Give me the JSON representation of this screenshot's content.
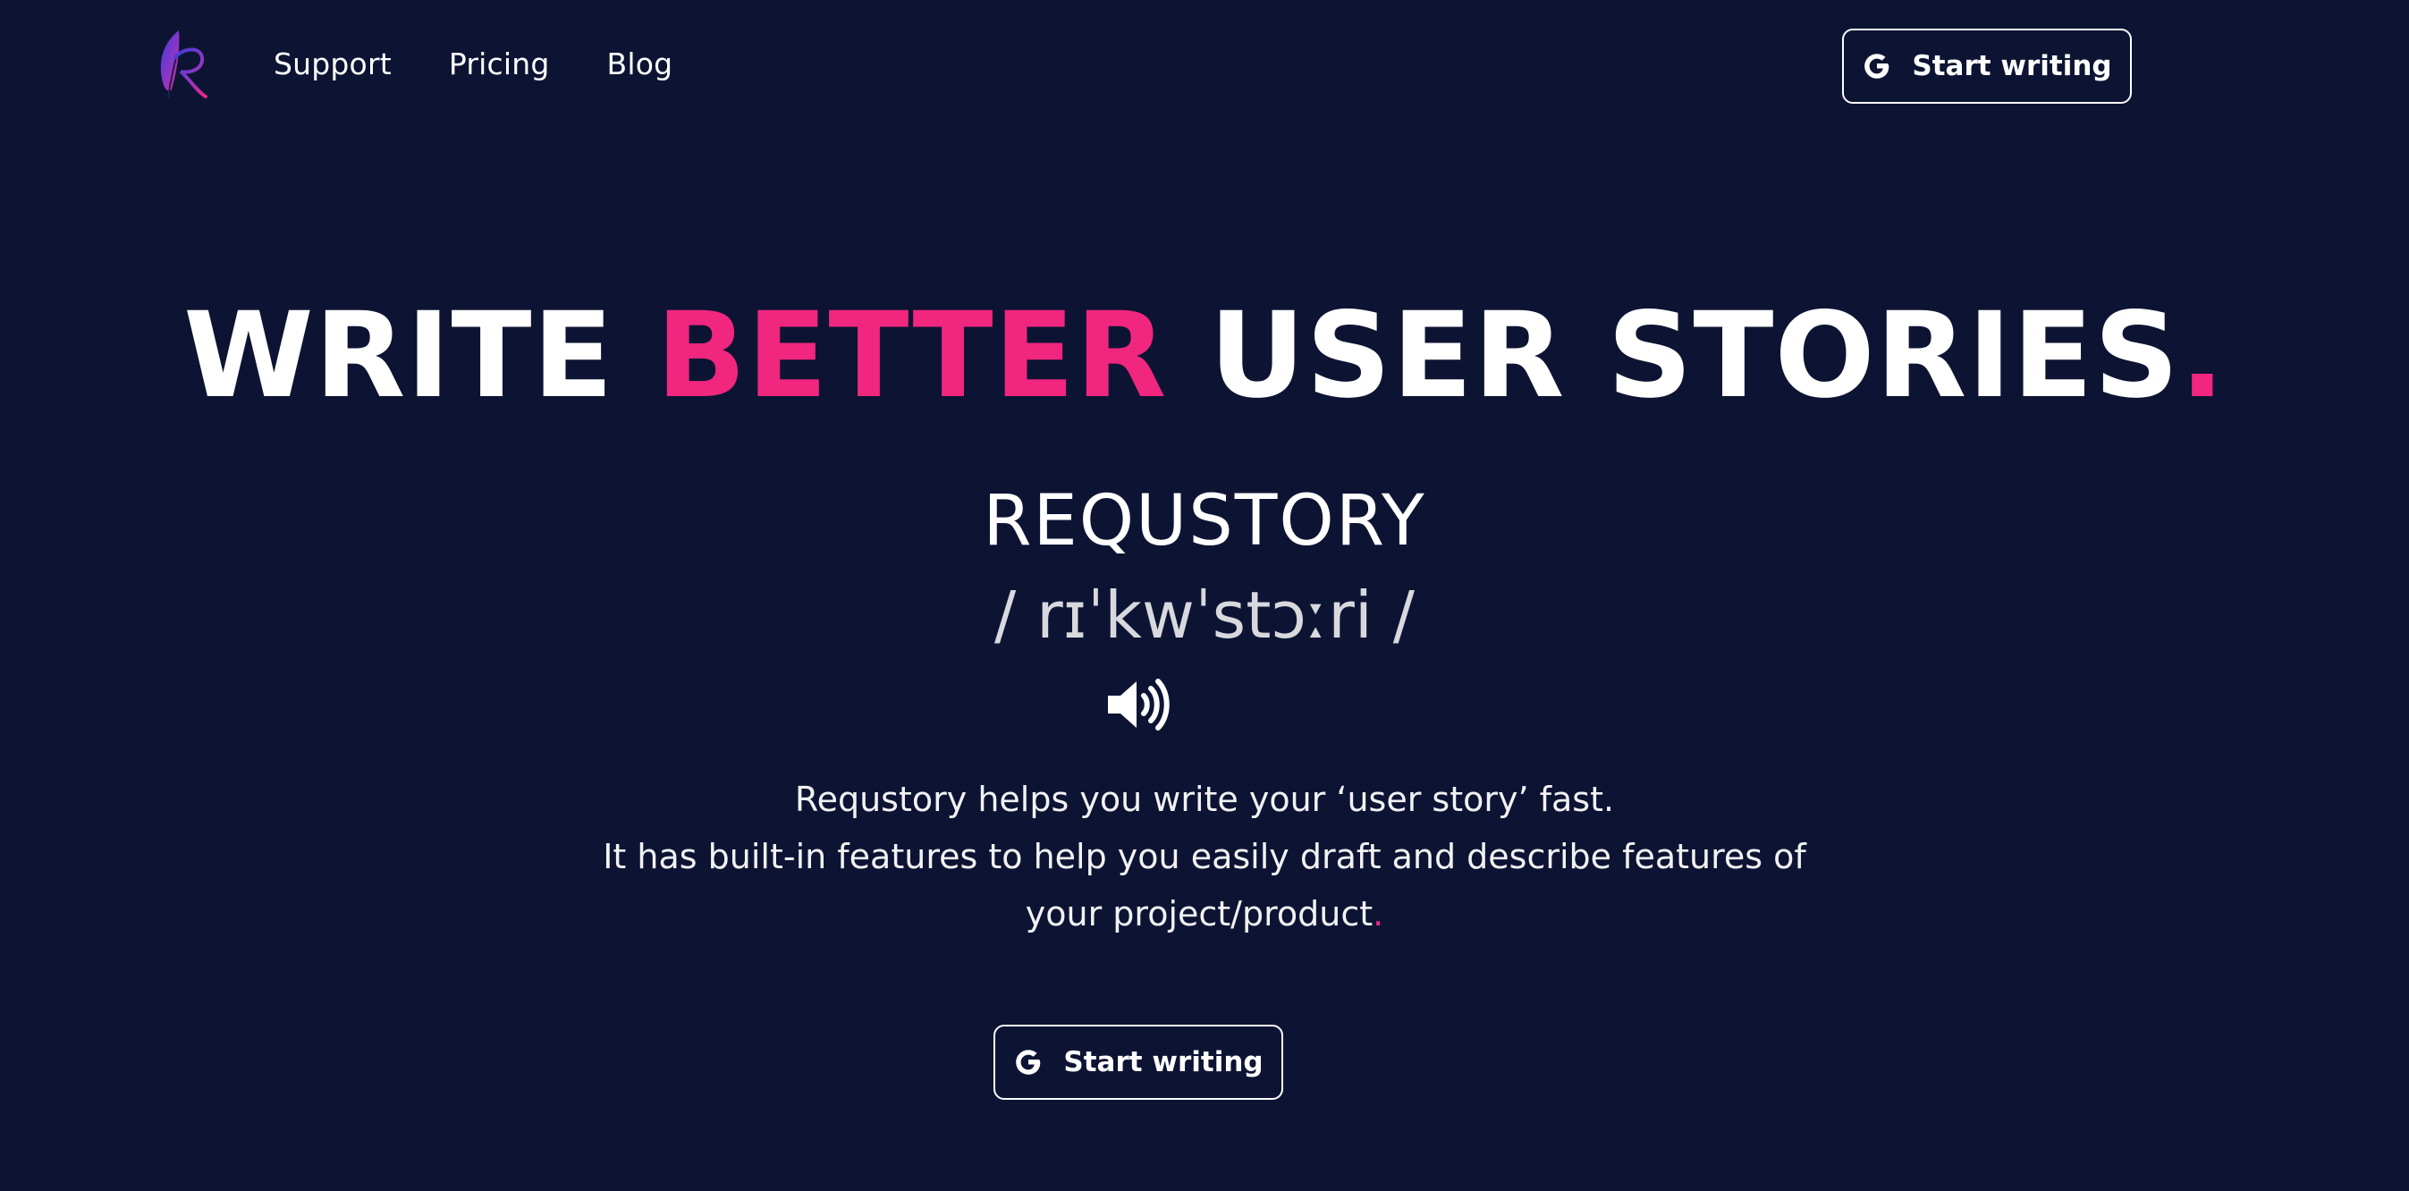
{
  "header": {
    "logo_alt": "R",
    "nav": [
      {
        "label": "Support"
      },
      {
        "label": "Pricing"
      },
      {
        "label": "Blog"
      }
    ],
    "cta_label": "Start writing"
  },
  "hero": {
    "headline": {
      "part1": "WRITE ",
      "accent": "BETTER",
      "part2": " USER STORIES",
      "dot": "."
    },
    "brand_word": "REQUSTORY",
    "phonetic": "/ rɪˈkwˈstɔːri /",
    "description": {
      "line1": "Requstory helps you write your ‘user story’ fast.",
      "line2": "It has built-in features to help you easily draft and describe features of",
      "line3": "your project/product",
      "dot": "."
    },
    "cta_label": "Start writing"
  },
  "colors": {
    "background": "#0d1433",
    "accent": "#f0267f",
    "text": "#ffffff"
  },
  "icons": {
    "logo": "feather-r-logo",
    "google": "google-g-icon",
    "speaker": "speaker-volume-icon"
  }
}
